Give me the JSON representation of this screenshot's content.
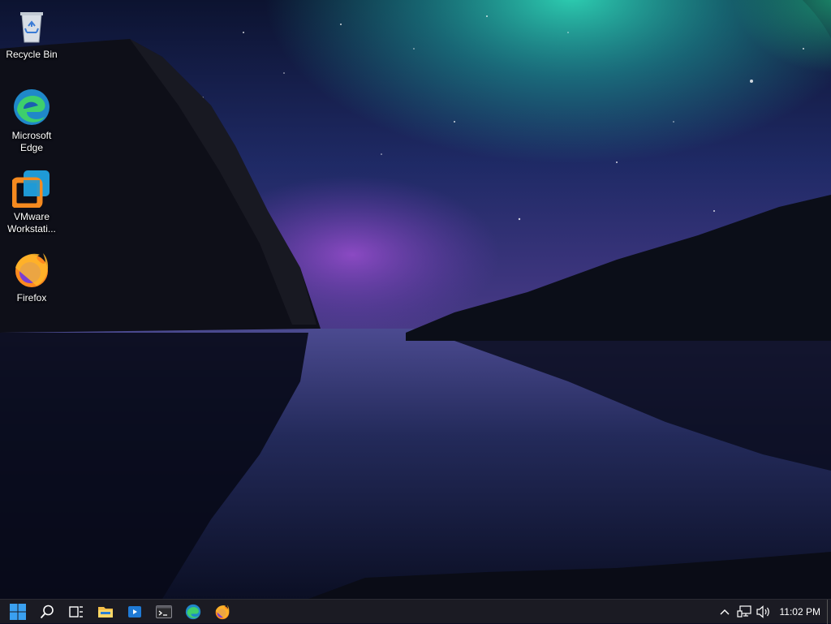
{
  "desktop": {
    "icons": [
      {
        "label": "Recycle Bin",
        "icon": "recycle-bin-icon"
      },
      {
        "label": "Microsoft Edge",
        "icon": "edge-icon"
      },
      {
        "label": "VMware Workstati...",
        "icon": "vmware-icon"
      },
      {
        "label": "Firefox",
        "icon": "firefox-icon"
      }
    ]
  },
  "taskbar": {
    "items": [
      {
        "icon": "start-windows-icon"
      },
      {
        "icon": "search-icon"
      },
      {
        "icon": "task-view-icon"
      },
      {
        "icon": "file-explorer-icon"
      },
      {
        "icon": "media-player-icon"
      },
      {
        "icon": "terminal-icon"
      },
      {
        "icon": "edge-icon"
      },
      {
        "icon": "firefox-icon"
      }
    ],
    "tray": {
      "icons": [
        "chevron-up-icon",
        "network-icon",
        "volume-icon"
      ],
      "clock": "11:02 PM"
    }
  },
  "colors": {
    "taskbar": "#1b1b23",
    "accent": "#0078d4"
  }
}
